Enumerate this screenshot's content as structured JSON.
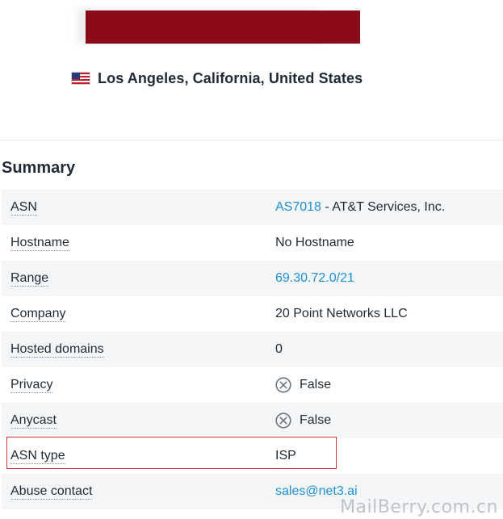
{
  "location": {
    "flag_icon": "us-flag-icon",
    "text": "Los Angeles, California, United States"
  },
  "summary": {
    "title": "Summary",
    "rows": [
      {
        "label": "ASN",
        "value_link": "AS7018",
        "value_rest": " - AT&T Services, Inc."
      },
      {
        "label": "Hostname",
        "value": "No Hostname"
      },
      {
        "label": "Range",
        "value_link": "69.30.72.0/21"
      },
      {
        "label": "Company",
        "value": "20 Point Networks LLC"
      },
      {
        "label": "Hosted domains",
        "value": "0"
      },
      {
        "label": "Privacy",
        "icon": "x-circle-icon",
        "value": "False"
      },
      {
        "label": "Anycast",
        "icon": "x-circle-icon",
        "value": "False"
      },
      {
        "label": "ASN type",
        "value": "ISP"
      },
      {
        "label": "Abuse contact",
        "value_link": "sales@net3.ai"
      }
    ]
  },
  "watermark": "MailBerry.com.cn",
  "colors": {
    "link": "#1f8fd6",
    "redaction": "#8a0a1a",
    "highlight": "#d9343c"
  }
}
